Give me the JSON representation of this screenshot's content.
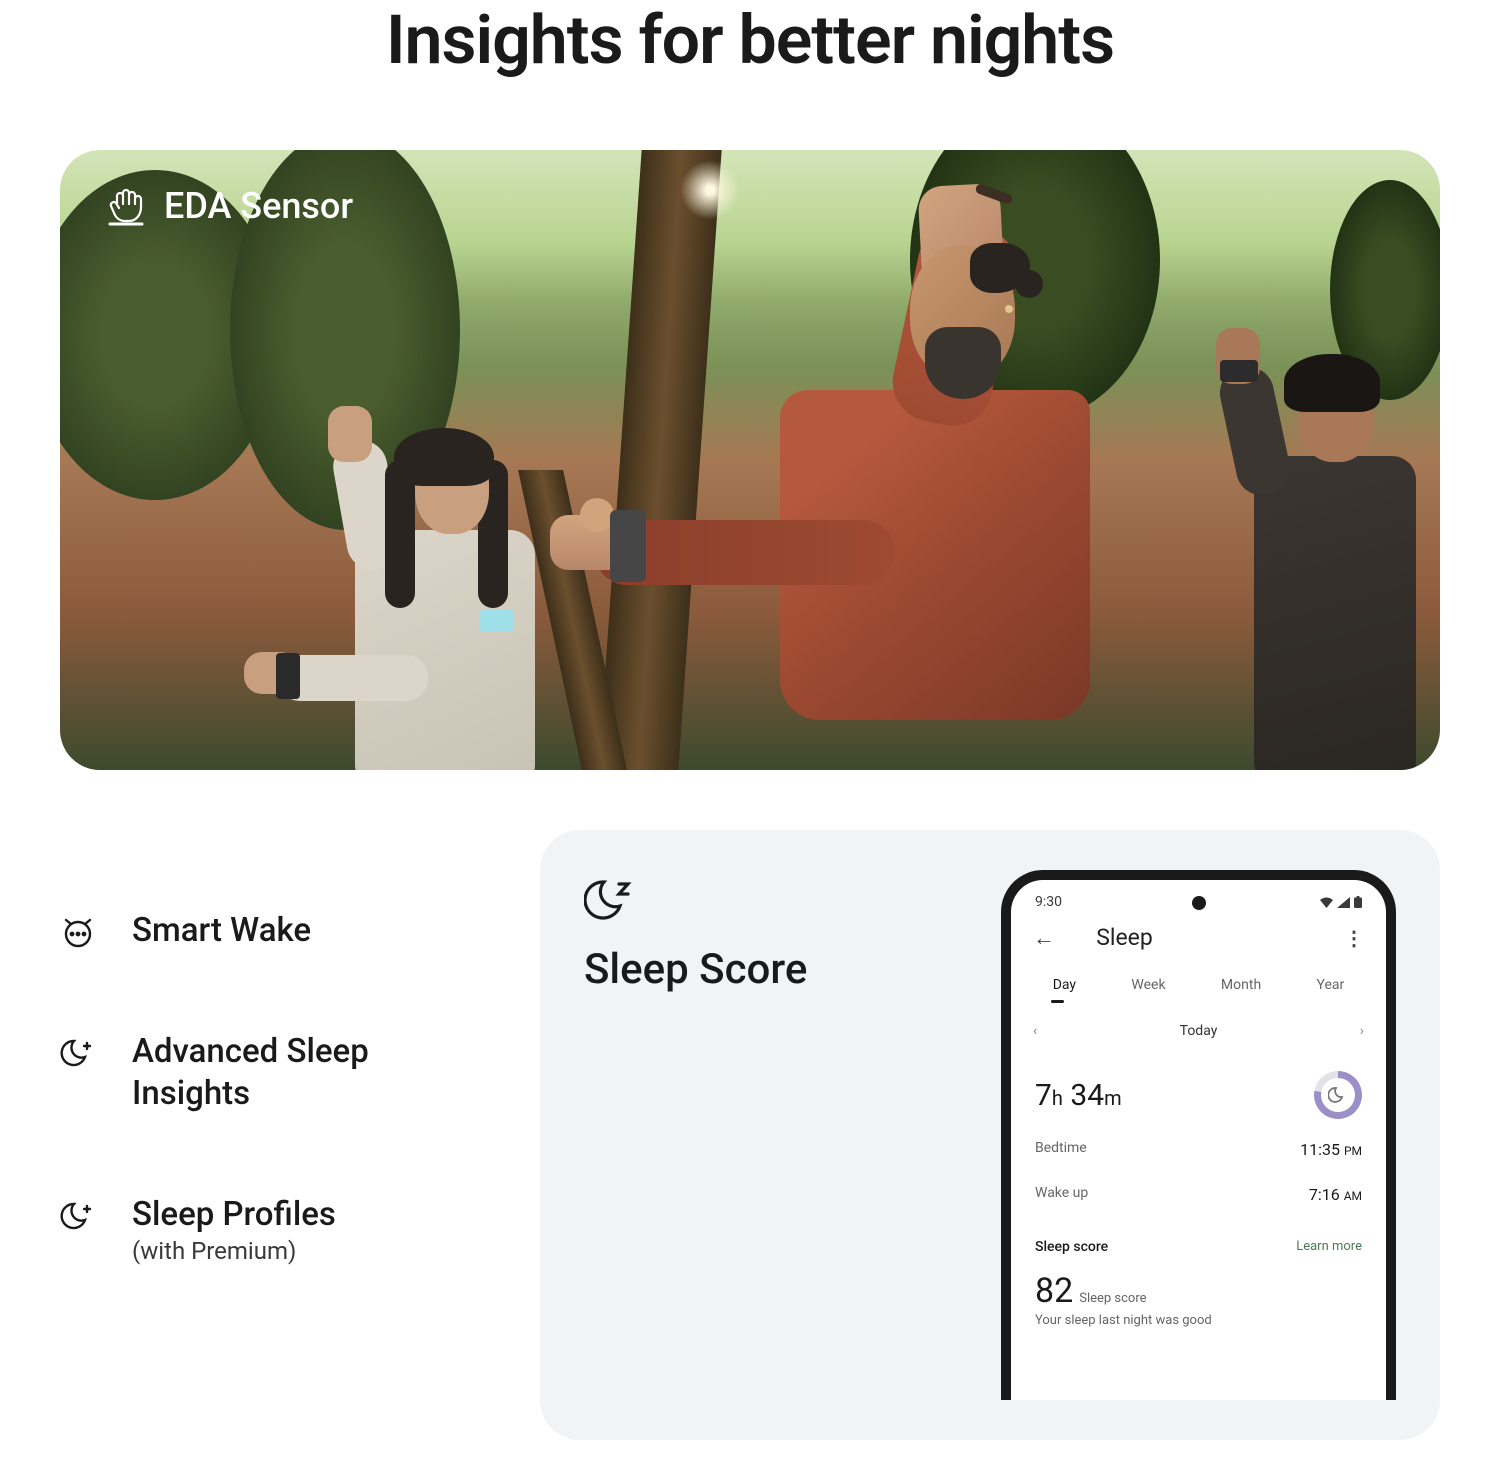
{
  "page": {
    "title": "Insights for better nights"
  },
  "hero": {
    "label": "EDA Sensor"
  },
  "features": [
    {
      "icon": "alarm",
      "title": "Smart Wake",
      "sub": ""
    },
    {
      "icon": "moon-plus",
      "title": "Advanced Sleep Insights",
      "sub": ""
    },
    {
      "icon": "moon-plus",
      "title": "Sleep Profiles",
      "sub": "(with Premium)"
    }
  ],
  "score": {
    "title": "Sleep Score"
  },
  "phone": {
    "time": "9:30",
    "header": {
      "title": "Sleep"
    },
    "tabs": [
      {
        "label": "Day",
        "active": true
      },
      {
        "label": "Week",
        "active": false
      },
      {
        "label": "Month",
        "active": false
      },
      {
        "label": "Year",
        "active": false
      }
    ],
    "date_label": "Today",
    "duration": {
      "hours": "7",
      "h_unit": "h",
      "minutes": "34",
      "m_unit": "m"
    },
    "stats": {
      "bedtime": {
        "label": "Bedtime",
        "value": "11:35",
        "suffix": "PM"
      },
      "wakeup": {
        "label": "Wake up",
        "value": "7:16",
        "suffix": "AM"
      }
    },
    "sleep_score": {
      "section_label": "Sleep score",
      "learn_more": "Learn more",
      "value": "82",
      "label": "Sleep score",
      "summary": "Your sleep last night was good"
    }
  }
}
